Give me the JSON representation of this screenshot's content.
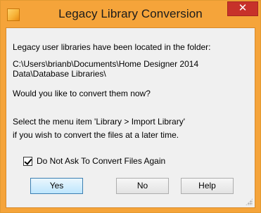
{
  "window": {
    "title": "Legacy Library Conversion",
    "close_glyph": "✕"
  },
  "message": {
    "line1": "Legacy user libraries have been located in the folder:",
    "path": "C:\\Users\\brianb\\Documents\\Home Designer 2014\nData\\Database Libraries\\",
    "question": "Would you like to convert them now?",
    "hint_line1": "Select the menu item 'Library > Import Library'",
    "hint_line2": "if you wish to convert the files at a later time."
  },
  "checkbox": {
    "label": "Do Not Ask To Convert Files Again",
    "checked": true
  },
  "buttons": {
    "yes": "Yes",
    "no": "No",
    "help": "Help"
  }
}
